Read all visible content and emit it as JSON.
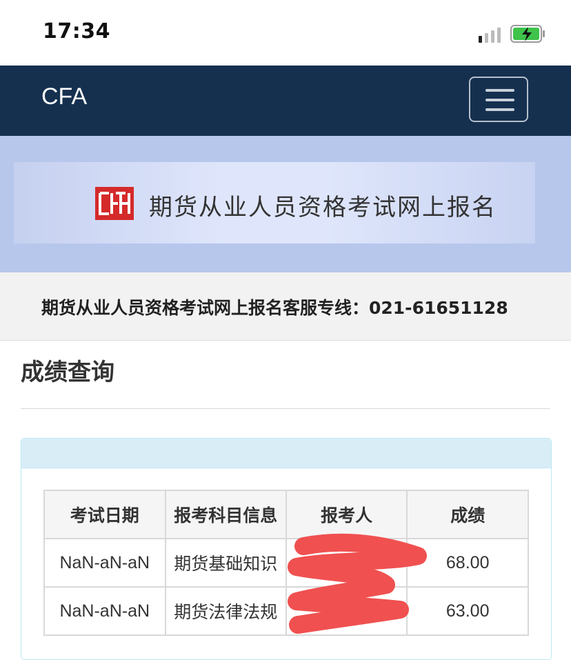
{
  "status_bar": {
    "time": "17:34",
    "signal_icon": "signal-bars-icon",
    "battery_icon": "battery-charging-icon"
  },
  "navbar": {
    "brand": "CFA",
    "menu_icon": "hamburger-menu-icon"
  },
  "banner": {
    "logo": "cfa-logo-icon",
    "title": "期货从业人员资格考试网上报名"
  },
  "hotline": {
    "text": "期货从业人员资格考试网上报名客服专线：021-61651128"
  },
  "section": {
    "title": "成绩查询"
  },
  "table": {
    "headers": [
      "考试日期",
      "报考科目信息",
      "报考人",
      "成绩"
    ],
    "rows": [
      {
        "date": "NaN-aN-aN",
        "subject": "期货基础知识",
        "person": "",
        "score": "68.00"
      },
      {
        "date": "NaN-aN-aN",
        "subject": "期货法律法规",
        "person": "",
        "score": "63.00"
      }
    ]
  },
  "colors": {
    "navbar": "#15304f",
    "banner": "#b7c7ec",
    "panel_head": "#d9edf7",
    "logo": "#d42a2a",
    "redaction": "#f05050"
  }
}
